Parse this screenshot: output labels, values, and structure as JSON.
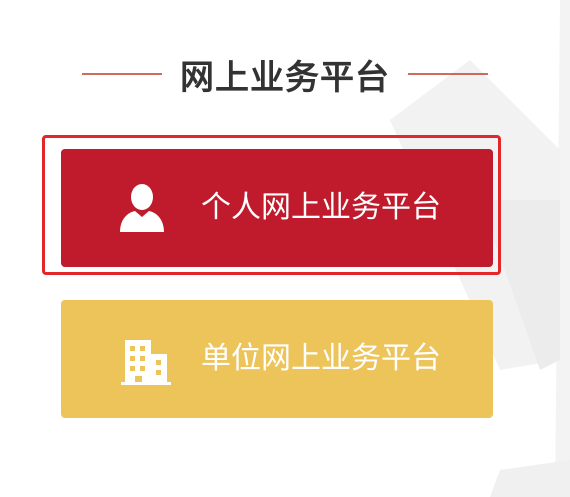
{
  "header": {
    "title": "网上业务平台"
  },
  "buttons": {
    "personal": {
      "label": "个人网上业务平台",
      "icon": "user-icon"
    },
    "unit": {
      "label": "单位网上业务平台",
      "icon": "building-icon"
    }
  },
  "colors": {
    "accent_red": "#bf1b2c",
    "focus_red": "#e2272b",
    "gold": "#ecc45a",
    "title": "#333333"
  }
}
